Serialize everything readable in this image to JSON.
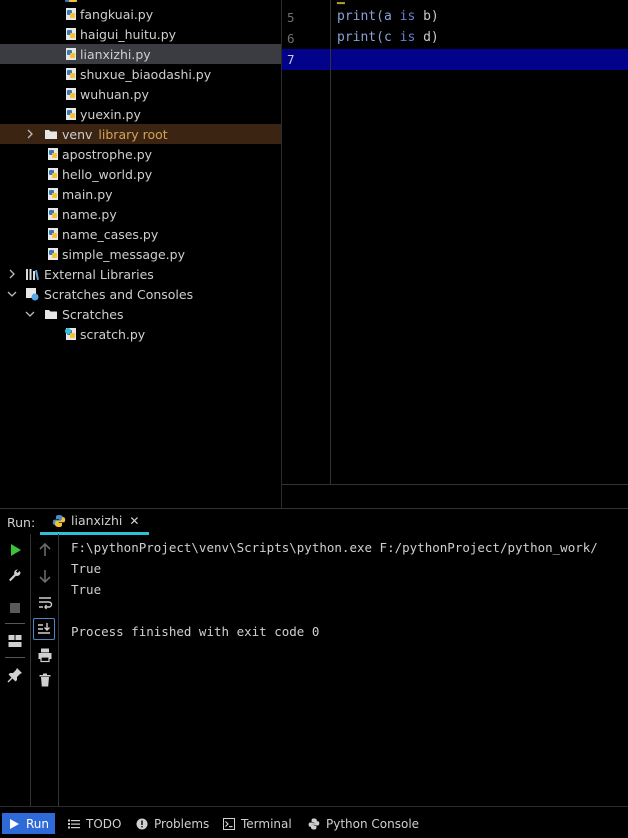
{
  "project_tree": {
    "items": [
      {
        "label": "fangkuai.py",
        "sub": ""
      },
      {
        "label": "haigui_huitu.py",
        "sub": ""
      },
      {
        "label": "lianxizhi.py",
        "sub": ""
      },
      {
        "label": "shuxue_biaodashi.py",
        "sub": ""
      },
      {
        "label": "wuhuan.py",
        "sub": ""
      },
      {
        "label": "yuexin.py",
        "sub": ""
      },
      {
        "label": "venv",
        "sub": "library root"
      },
      {
        "label": "apostrophe.py",
        "sub": ""
      },
      {
        "label": "hello_world.py",
        "sub": ""
      },
      {
        "label": "main.py",
        "sub": ""
      },
      {
        "label": "name.py",
        "sub": ""
      },
      {
        "label": "name_cases.py",
        "sub": ""
      },
      {
        "label": "simple_message.py",
        "sub": ""
      },
      {
        "label": "External Libraries",
        "sub": ""
      },
      {
        "label": "Scratches and Consoles",
        "sub": ""
      },
      {
        "label": "Scratches",
        "sub": ""
      },
      {
        "label": "scratch.py",
        "sub": ""
      }
    ]
  },
  "editor": {
    "lines": [
      {
        "num": "5",
        "pre": "print(a ",
        "kw": "is",
        "post": " b)"
      },
      {
        "num": "6",
        "pre": "print(c ",
        "kw": "is",
        "post": " d)"
      },
      {
        "num": "7",
        "pre": "",
        "kw": "",
        "post": ""
      }
    ],
    "current_line": "7"
  },
  "run": {
    "title": "Run:",
    "tab_label": "lianxizhi",
    "tab_close": "✕",
    "console_lines": [
      "F:\\pythonProject\\venv\\Scripts\\python.exe F:/pythonProject/python_work/",
      "True",
      "True",
      "",
      "Process finished with exit code 0"
    ]
  },
  "bottom_bar": {
    "run": "Run",
    "todo": "TODO",
    "problems": "Problems",
    "terminal": "Terminal",
    "python_console": "Python Console"
  },
  "colors": {
    "accent_blue": "#2f6bd8",
    "tab_underline": "#2fbfd9",
    "current_line": "#02028a",
    "run_green": "#3bc43b"
  }
}
